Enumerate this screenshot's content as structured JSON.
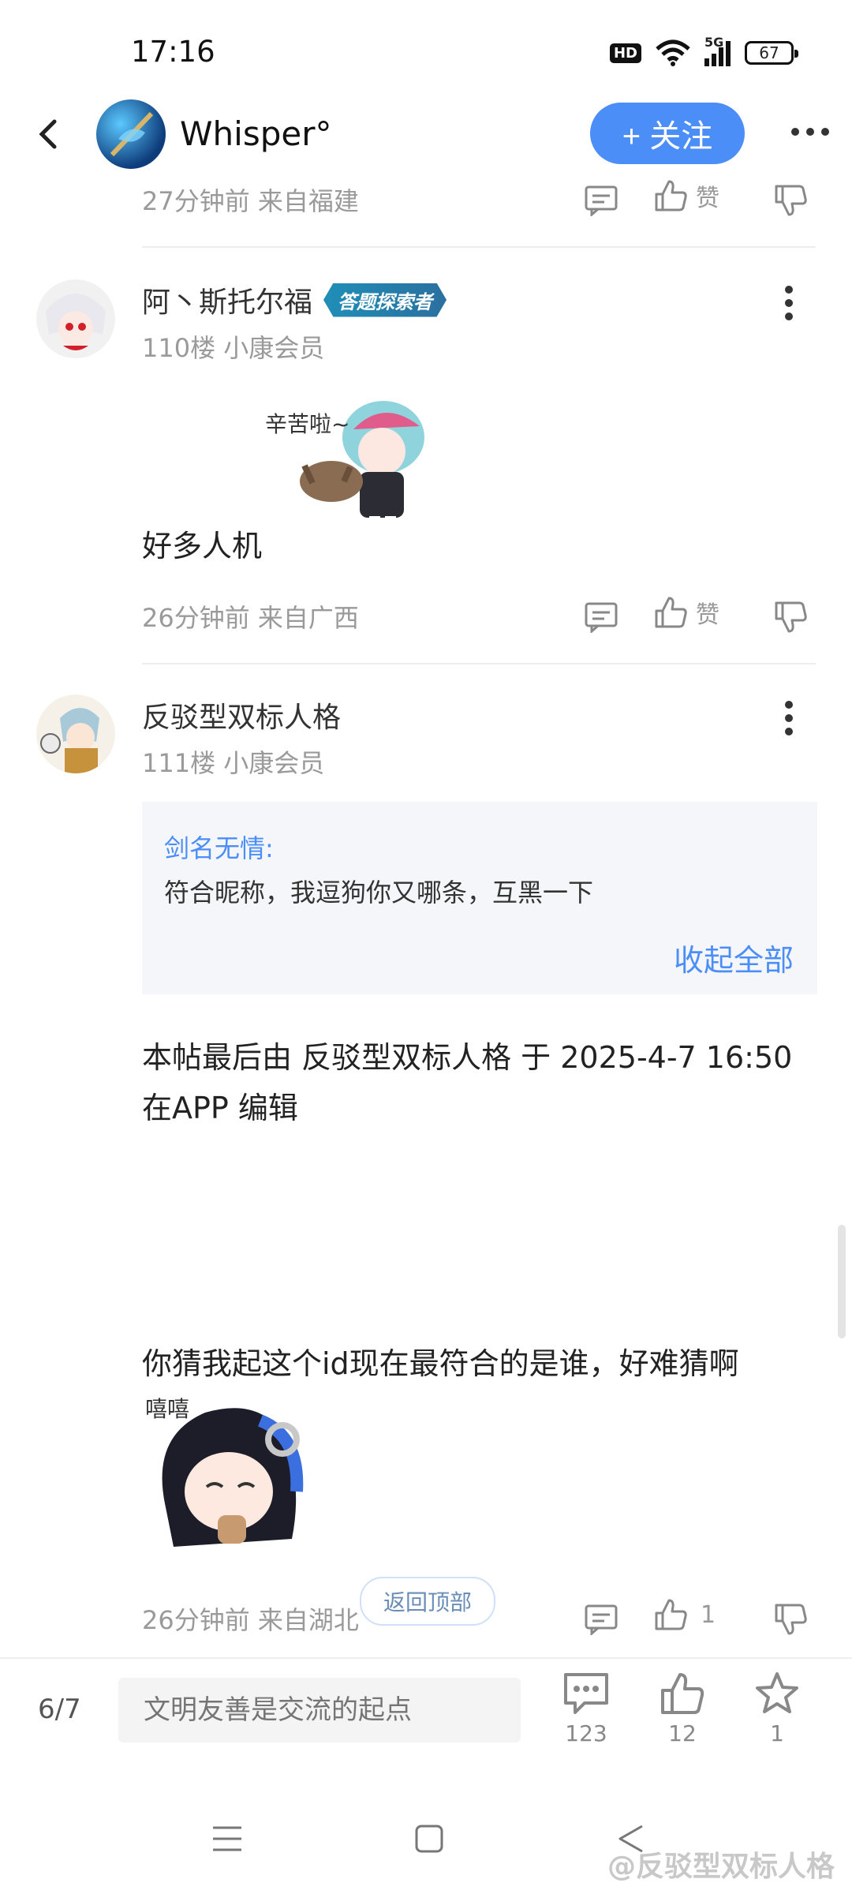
{
  "status_bar": {
    "time": "17:16",
    "hd": "HD",
    "network": "5G",
    "battery": "67"
  },
  "header": {
    "title": "Whisper°",
    "follow_label": "+ 关注"
  },
  "top_post_meta": {
    "time_location": "27分钟前 来自福建",
    "like_label": "赞"
  },
  "posts": [
    {
      "username": "阿丶斯托尔福",
      "badge": "答题探索者",
      "floor": "110楼 小康会员",
      "sticker_text": "辛苦啦~",
      "text": "好多人机",
      "time_location": "26分钟前 来自广西",
      "like_label": "赞"
    },
    {
      "username": "反驳型双标人格",
      "floor": "111楼 小康会员",
      "quote": {
        "author": "剑名无情:",
        "text": "符合昵称，我逗狗你又哪条，互黑一下",
        "collapse_label": "收起全部"
      },
      "edit_line1": "本帖最后由 反驳型双标人格 于 2025-4-7 16:50",
      "edit_line2": "在APP 编辑",
      "text2": "你猜我起这个id现在最符合的是谁，好难猜啊",
      "sticker_text": "嘻嘻",
      "time_location": "26分钟前 来自湖北",
      "like_count": "1"
    }
  ],
  "back_to_top_label": "返回顶部",
  "bottom_bar": {
    "page": "6/7",
    "input_placeholder": "文明友善是交流的起点",
    "comment_count": "123",
    "like_count": "12",
    "favorite_count": "1"
  },
  "watermark": "@反驳型双标人格",
  "colors": {
    "accent": "#4b8ef7",
    "meta": "#9a9a9a"
  }
}
